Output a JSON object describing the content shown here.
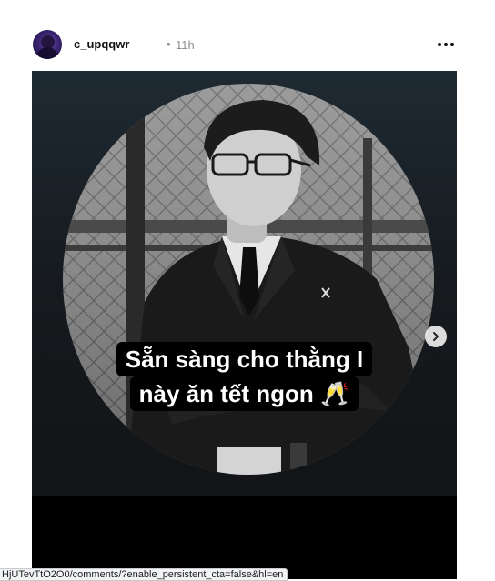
{
  "post": {
    "username": "c_upqqwr",
    "separator": "•",
    "timestamp": "11h",
    "more_icon": "more-horizontal-icon"
  },
  "media": {
    "caption_lines": [
      "Sẵn sàng cho thằng I",
      "này ăn tết ngon 🥂"
    ],
    "next_icon": "chevron-right-icon"
  },
  "status_bar": {
    "url": "HjUTevTtO2O0/comments/?enable_persistent_cta=false&hl=en"
  },
  "colors": {
    "text_primary": "#111111",
    "text_secondary": "#8e8e8e",
    "media_background": "#000000"
  }
}
